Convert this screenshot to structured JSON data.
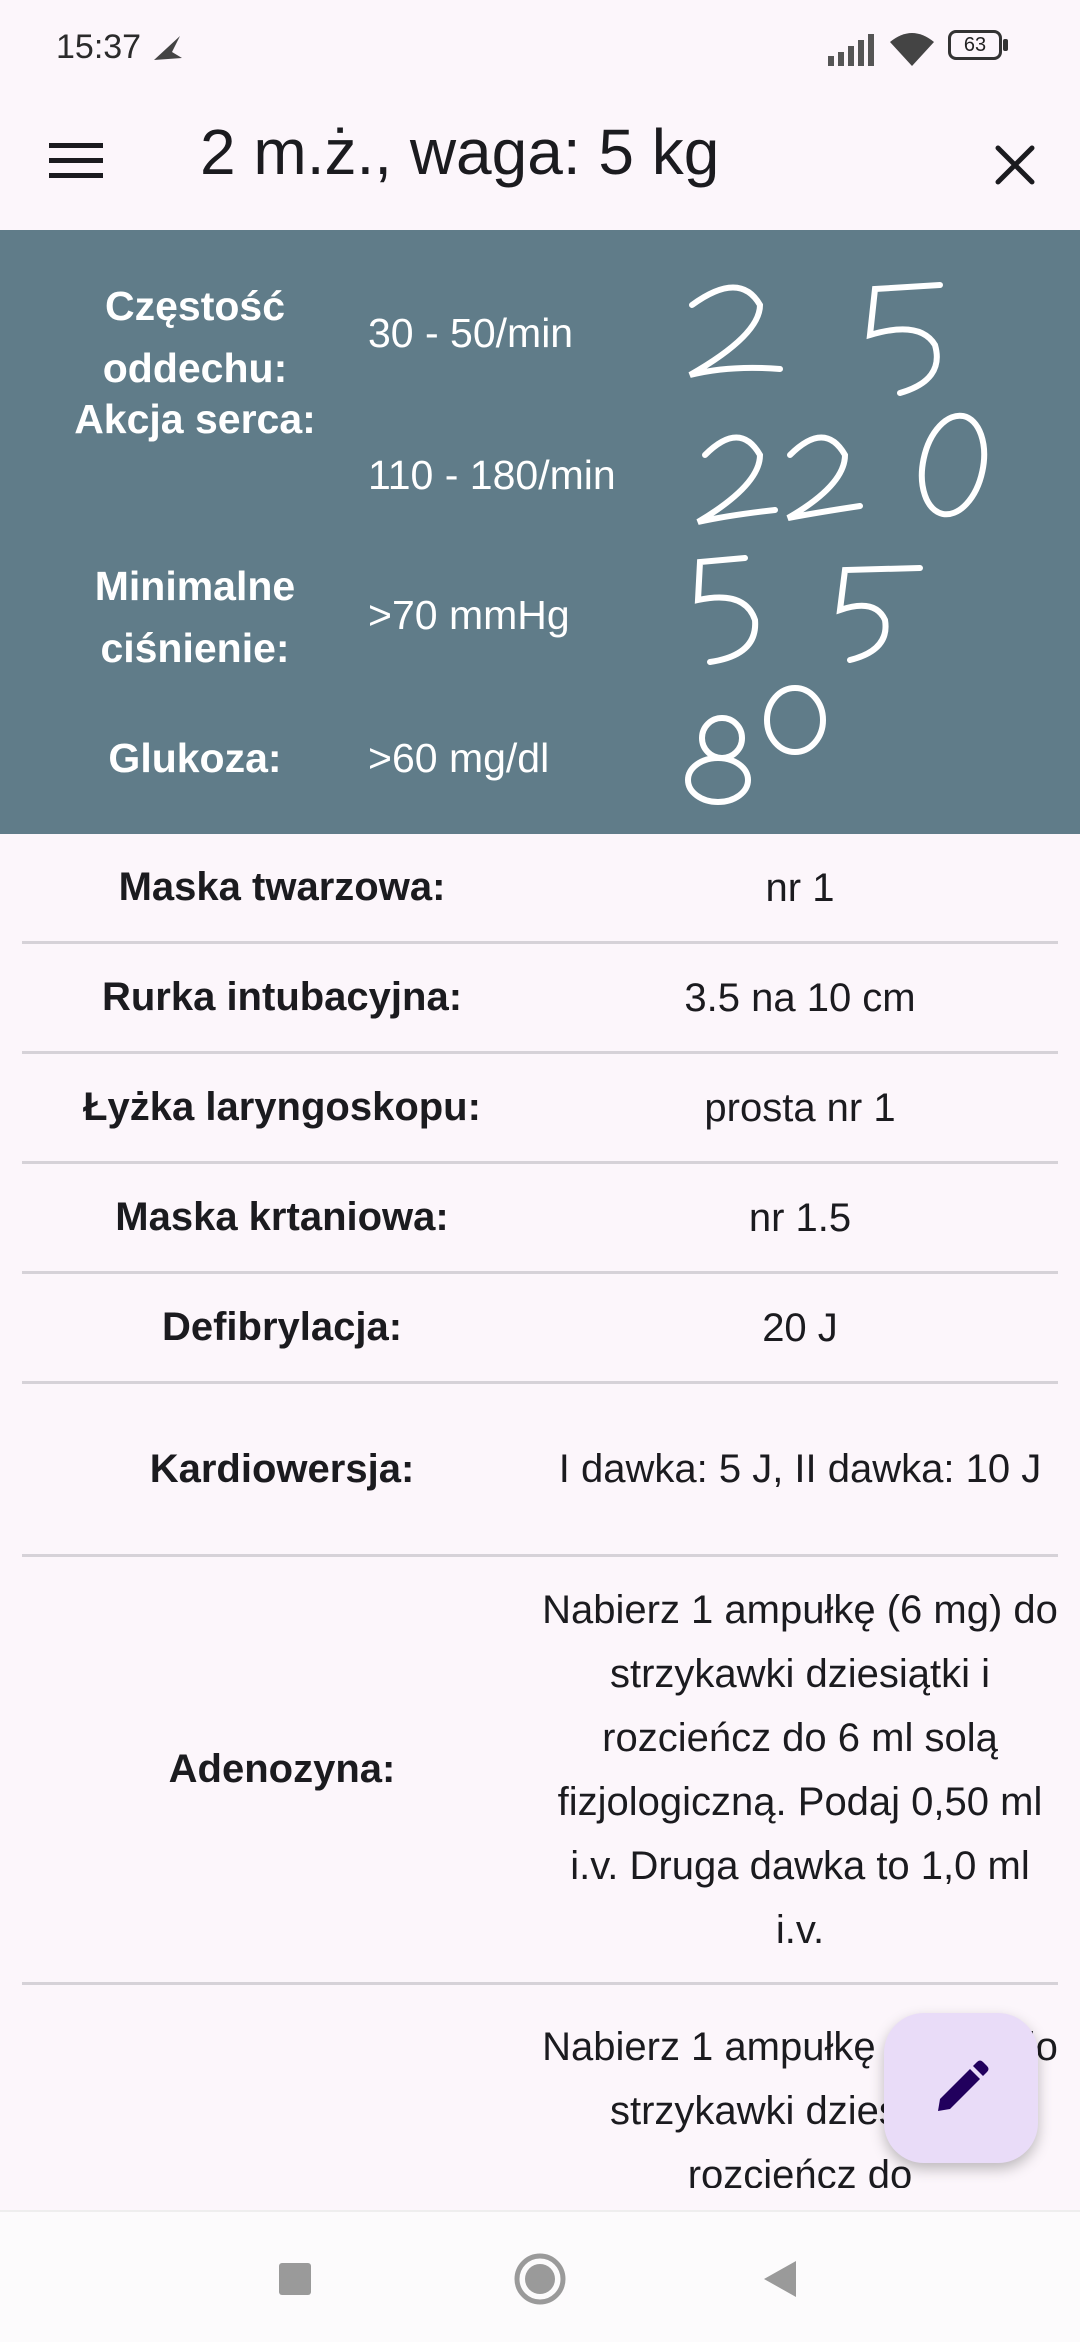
{
  "status_bar": {
    "time": "15:37",
    "battery": "63",
    "icons": [
      "signal-icon",
      "wifi-icon",
      "battery-icon",
      "notification-icon"
    ]
  },
  "app_bar": {
    "title": "2 m.ż., waga: 5 kg",
    "menu_icon": "menu-icon",
    "close_icon": "close-icon"
  },
  "vitals": [
    {
      "label": "Częstość oddechu:",
      "range": "30 - 50/min",
      "entered": "25"
    },
    {
      "label": "Akcja serca:",
      "range": "110 - 180/min",
      "entered": "220"
    },
    {
      "label": "Minimalne ciśnienie:",
      "range": ">70 mmHg",
      "entered": "55"
    },
    {
      "label": "Glukoza:",
      "range": ">60 mg/dl",
      "entered": "80"
    }
  ],
  "rows": [
    {
      "label": "Maska twarzowa:",
      "value": "nr 1"
    },
    {
      "label": "Rurka intubacyjna:",
      "value": "3.5 na 10 cm"
    },
    {
      "label": "Łyżka laryngoskopu:",
      "value": "prosta nr 1"
    },
    {
      "label": "Maska krtaniowa:",
      "value": "nr 1.5"
    },
    {
      "label": "Defibrylacja:",
      "value": "20 J"
    },
    {
      "label": "Kardiowersja:",
      "value": "I dawka: 5 J, II dawka: 10 J"
    },
    {
      "label": "Adenozyna:",
      "value": "Nabierz 1 ampułkę (6 mg) do strzykawki dziesiątki i rozcieńcz do 6 ml solą fizjologiczną. Podaj  0,50 ml i.v. Druga dawka to 1,0 ml i.v."
    },
    {
      "label": "",
      "value": "Nabierz 1 ampułkę (6 mg) do strzykawki dziesiątki i rozcieńcz do"
    }
  ],
  "fab": {
    "icon": "edit-pencil-icon"
  },
  "nav": {
    "icons": [
      "recent-apps-icon",
      "home-icon",
      "back-icon"
    ]
  },
  "colors": {
    "vitals_bg": "#607c89",
    "fab_bg": "#e9dcf8",
    "fab_icon": "#21005d"
  }
}
